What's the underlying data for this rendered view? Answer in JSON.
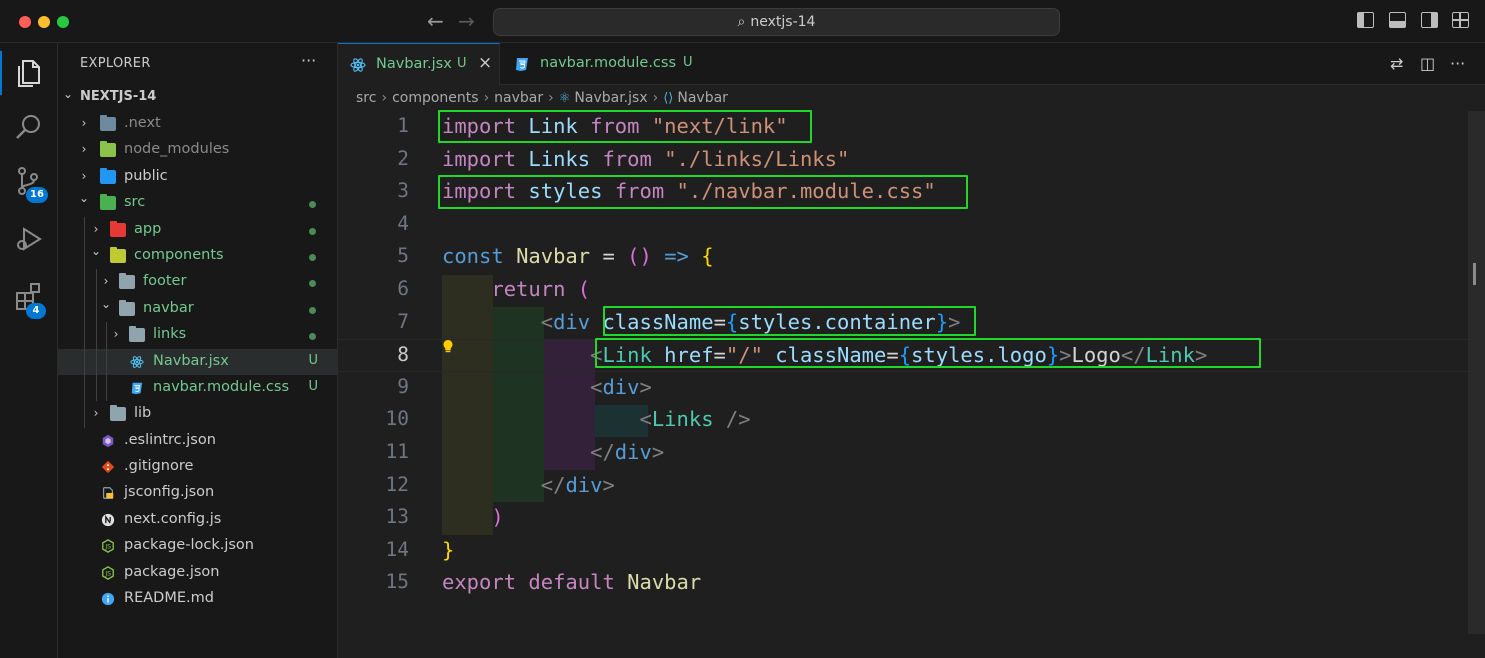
{
  "window": {
    "search_text": "nextjs-14"
  },
  "activity_bar": {
    "items": [
      {
        "name": "explorer",
        "icon": "files-icon"
      },
      {
        "name": "search",
        "icon": "search-icon"
      },
      {
        "name": "source-control",
        "icon": "source-control-icon",
        "badge": "16"
      },
      {
        "name": "run-debug",
        "icon": "run-debug-icon"
      },
      {
        "name": "extensions",
        "icon": "extensions-icon",
        "badge": "4"
      }
    ]
  },
  "explorer": {
    "title": "EXPLORER",
    "more": "···",
    "root": "NEXTJS-14",
    "tree": [
      {
        "label": ".next",
        "chev": "›"
      },
      {
        "label": "node_modules",
        "chev": "›"
      },
      {
        "label": "public",
        "chev": "›"
      },
      {
        "label": "src",
        "chev": "⌄"
      },
      {
        "label": "app",
        "chev": "›"
      },
      {
        "label": "components",
        "chev": "⌄"
      },
      {
        "label": "footer",
        "chev": "›"
      },
      {
        "label": "navbar",
        "chev": "⌄"
      },
      {
        "label": "links",
        "chev": "›"
      },
      {
        "label": "Navbar.jsx",
        "status": "U"
      },
      {
        "label": "navbar.module.css",
        "status": "U"
      },
      {
        "label": "lib",
        "chev": "›"
      },
      {
        "label": ".eslintrc.json"
      },
      {
        "label": ".gitignore"
      },
      {
        "label": "jsconfig.json"
      },
      {
        "label": "next.config.js"
      },
      {
        "label": "package-lock.json"
      },
      {
        "label": "package.json"
      },
      {
        "label": "README.md"
      }
    ]
  },
  "tabs": [
    {
      "label": "Navbar.jsx",
      "status": "U",
      "close": "×"
    },
    {
      "label": "navbar.module.css",
      "status": "U"
    }
  ],
  "breadcrumbs": [
    "src",
    "components",
    "navbar",
    "Navbar.jsx",
    "Navbar"
  ],
  "code": {
    "line_numbers": [
      "1",
      "2",
      "3",
      "4",
      "5",
      "6",
      "7",
      "8",
      "9",
      "10",
      "11",
      "12",
      "13",
      "14",
      "15"
    ],
    "tokens": {
      "import": "import",
      "from": "from",
      "const": "const",
      "return": "return",
      "export": "export",
      "default": "default",
      "Link": "Link",
      "Links": "Links",
      "styles": "styles",
      "Navbar": "Navbar",
      "s1": "\"next/link\"",
      "s2": "\"./links/Links\"",
      "s3": "\"./navbar.module.css\"",
      "s_href": "\"/\"",
      "eq": "=",
      "paren_open": "(",
      "paren_close": ")",
      "arrow": "=>",
      "brace_open": "{",
      "brace_close": "}",
      "lt": "<",
      "gt": ">",
      "lt_slash": "</",
      "self_close": "/>",
      "div": "div",
      "className": "className",
      "href": "href",
      "styles_container": "styles.container",
      "styles_logo": "styles.logo",
      "logo_text": "Logo"
    }
  }
}
